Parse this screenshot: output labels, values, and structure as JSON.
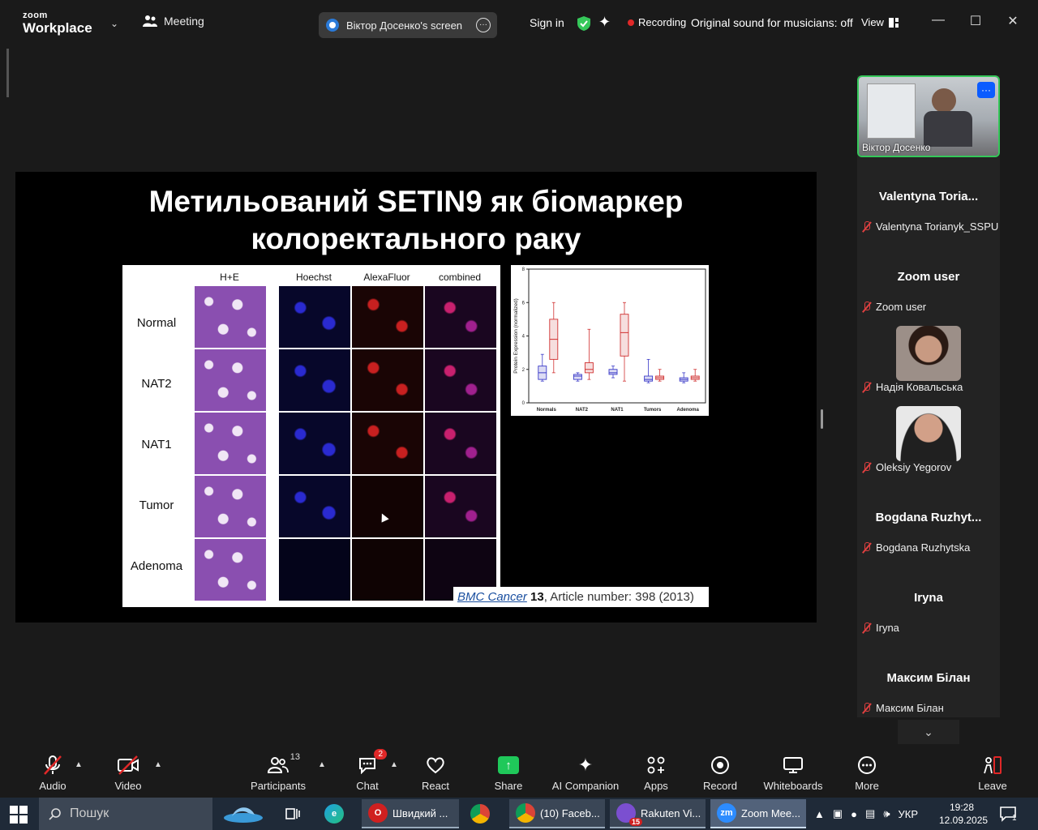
{
  "topbar": {
    "logo_line1": "zoom",
    "logo_line2": "Workplace",
    "meeting_label": "Meeting",
    "screen_label": "Віктор Досенко's screen",
    "sign_in": "Sign in",
    "recording": "Recording",
    "original_sound": "Original sound for musicians: off",
    "view": "View"
  },
  "slide": {
    "title_line1": "Метильований SETIN9 як біомаркер",
    "title_line2": "колоректального раку",
    "figure_columns": [
      "H+E",
      "Hoechst",
      "AlexaFluor",
      "combined"
    ],
    "figure_rows": [
      "Normal",
      "NAT2",
      "NAT1",
      "Tumor",
      "Adenoma"
    ],
    "citation_journal": "BMC Cancer",
    "citation_volume": "13",
    "citation_rest": ", Article number: 398 (2013)"
  },
  "chart_data": {
    "type": "box",
    "ylabel": "Protein Expression (normalized)",
    "ylim": [
      0,
      8
    ],
    "yticks": [
      "0",
      "2",
      "4",
      "6",
      "8"
    ],
    "categories": [
      "Normals",
      "NAT2",
      "NAT1",
      "Tumors",
      "Adenoma"
    ],
    "series": [
      {
        "color": "#3a3ac8",
        "boxes": [
          {
            "min": 1.3,
            "q1": 1.4,
            "median": 1.8,
            "q3": 2.2,
            "max": 2.9
          },
          {
            "min": 1.3,
            "q1": 1.4,
            "median": 1.6,
            "q3": 1.7,
            "max": 1.8
          },
          {
            "min": 1.5,
            "q1": 1.7,
            "median": 1.8,
            "q3": 2.0,
            "max": 2.2
          },
          {
            "min": 1.2,
            "q1": 1.3,
            "median": 1.4,
            "q3": 1.6,
            "max": 2.6
          },
          {
            "min": 1.2,
            "q1": 1.3,
            "median": 1.4,
            "q3": 1.5,
            "max": 1.8
          }
        ]
      },
      {
        "color": "#d03030",
        "boxes": [
          {
            "min": 1.8,
            "q1": 2.6,
            "median": 3.8,
            "q3": 5.0,
            "max": 6.0
          },
          {
            "min": 1.4,
            "q1": 1.8,
            "median": 2.0,
            "q3": 2.4,
            "max": 4.4
          },
          {
            "min": 1.3,
            "q1": 2.8,
            "median": 4.2,
            "q3": 5.3,
            "max": 6.0
          },
          {
            "min": 1.3,
            "q1": 1.4,
            "median": 1.5,
            "q3": 1.6,
            "max": 2.0
          },
          {
            "min": 1.3,
            "q1": 1.4,
            "median": 1.5,
            "q3": 1.6,
            "max": 2.0
          }
        ]
      }
    ]
  },
  "participants": {
    "active_name": "Віктор Досенко",
    "list": [
      {
        "display": "Valentyna  Toria...",
        "name": "Valentyna Torianyk_SSPU",
        "type": "text"
      },
      {
        "display": "Zoom user",
        "name": "Zoom user",
        "type": "text"
      },
      {
        "display": "",
        "name": "Надія Ковальська",
        "type": "photo"
      },
      {
        "display": "",
        "name": "Oleksiy Yegorov",
        "type": "photo"
      },
      {
        "display": "Bogdana  Ruzhyt...",
        "name": "Bogdana Ruzhytska",
        "type": "text"
      },
      {
        "display": "Iryna",
        "name": "Iryna",
        "type": "text"
      },
      {
        "display": "Максим Білан",
        "name": "Максим Білан",
        "type": "text"
      }
    ]
  },
  "toolbar": {
    "audio": "Audio",
    "video": "Video",
    "participants": "Participants",
    "participants_count": "13",
    "chat": "Chat",
    "chat_badge": "2",
    "react": "React",
    "share": "Share",
    "ai_companion": "AI Companion",
    "apps": "Apps",
    "record": "Record",
    "whiteboards": "Whiteboards",
    "more": "More",
    "leave": "Leave"
  },
  "taskbar": {
    "search_placeholder": "Пошук",
    "apps": [
      {
        "label": "Швидкий ...",
        "state": "open"
      },
      {
        "label": "(10) Faceb...",
        "state": "open"
      },
      {
        "label": "Rakuten Vi...",
        "state": "open",
        "badge": "15"
      },
      {
        "label": "Zoom Mee...",
        "state": "active"
      }
    ],
    "language": "УКР",
    "time": "19:28",
    "date": "12.09.2025",
    "notifications": "1"
  },
  "colors": {
    "accent_green": "#35c85a",
    "share_green": "#1fc85a",
    "zoom_blue": "#0b5cff",
    "recording_red": "#e02828"
  }
}
